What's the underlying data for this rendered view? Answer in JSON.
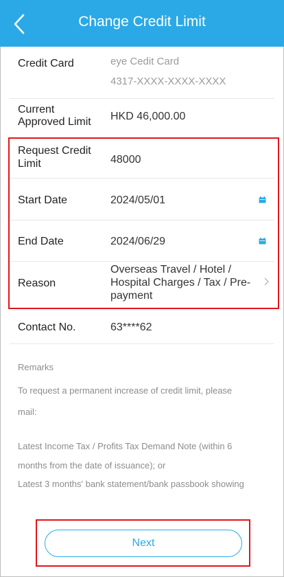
{
  "header": {
    "title": "Change Credit Limit"
  },
  "credit_card": {
    "label": "Credit Card",
    "name": "eye Cedit Card",
    "number": "4317-XXXX-XXXX-XXXX"
  },
  "current_limit": {
    "label_line1": "Current",
    "label_line2": "Approved Limit",
    "value": "HKD 46,000.00"
  },
  "request_limit": {
    "label_line1": "Request Credit",
    "label_line2": "Limit",
    "value": "48000"
  },
  "start_date": {
    "label": "Start Date",
    "value": "2024/05/01"
  },
  "end_date": {
    "label": "End Date",
    "value": "2024/06/29"
  },
  "reason": {
    "label": "Reason",
    "line1": "Overseas Travel / Hotel /",
    "line2": "Hospital Charges / Tax / Pre-",
    "line3": "payment"
  },
  "contact": {
    "label": "Contact No.",
    "value": "63****62"
  },
  "remarks": {
    "title": "Remarks",
    "line1": "To request a permanent increase of credit limit, please",
    "line2": "mail:",
    "line3": "Latest Income Tax / Profits Tax Demand Note (within 6",
    "line4": "months from the date of issuance); or",
    "line5": "Latest 3 months' bank statement/bank passbook showing"
  },
  "footer": {
    "next_label": "Next"
  },
  "colors": {
    "accent": "#2aa9e6",
    "highlight": "#e0151b"
  }
}
